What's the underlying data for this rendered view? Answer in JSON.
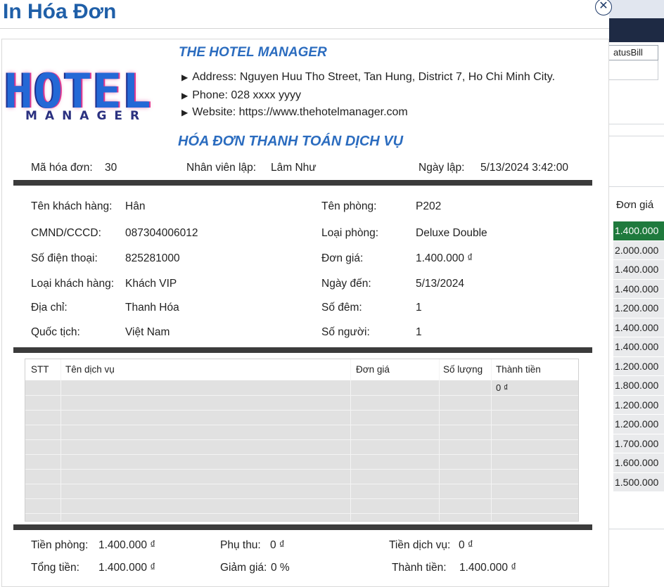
{
  "dialog": {
    "title": "In Hóa Đơn",
    "close_glyph": "✕"
  },
  "logo": {
    "main": "HOTEL",
    "sub": "MANAGER"
  },
  "company": {
    "name": "THE HOTEL MANAGER",
    "arrow": "▶",
    "address": "Address: Nguyen Huu Tho Street, Tan Hung, District 7, Ho Chi Minh City.",
    "phone": "Phone: 028 xxxx yyyy",
    "website": "Website: https://www.thehotelmanager.com"
  },
  "invoice": {
    "heading": "HÓA ĐƠN THANH TOÁN DỊCH VỤ",
    "id_label": "Mã hóa đơn:",
    "id_value": "30",
    "staff_label": "Nhân viên lập:",
    "staff_value": "Lâm Như",
    "date_label": "Ngày lập:",
    "date_value": "5/13/2024 3:42:00"
  },
  "customer": {
    "name_label": "Tên khách hàng:",
    "name_value": "Hân",
    "id_label": "CMND/CCCD:",
    "id_value": "087304006012",
    "phone_label": "Số điện thoại:",
    "phone_value": "825281000",
    "type_label": "Loại khách hàng:",
    "type_value": "Khách VIP",
    "address_label": "Địa chỉ:",
    "address_value": "Thanh Hóa",
    "nationality_label": "Quốc tịch:",
    "nationality_value": "Việt Nam"
  },
  "room": {
    "name_label": "Tên phòng:",
    "name_value": "P202",
    "type_label": "Loại phòng:",
    "type_value": "Deluxe Double",
    "price_label": "Đơn giá:",
    "price_value": "1.400.000 ₫",
    "arrival_label": "Ngày đến:",
    "arrival_value": "5/13/2024",
    "nights_label": "Số đêm:",
    "nights_value": "1",
    "people_label": "Số người:",
    "people_value": "1"
  },
  "services": {
    "columns": [
      "STT",
      "Tên dịch vụ",
      "Đơn giá",
      "Số lượng",
      "Thành tiền"
    ],
    "first_total": "0 ₫"
  },
  "summary": {
    "room_fee_label": "Tiền phòng:",
    "room_fee_value": "1.400.000 ₫",
    "surcharge_label": "Phụ thu:",
    "surcharge_value": "0 ₫",
    "service_fee_label": "Tiền dịch vụ:",
    "service_fee_value": "0 ₫",
    "total_label": "Tổng tiền:",
    "total_value": "1.400.000 ₫",
    "discount_label": "Giảm giá:",
    "discount_value": "0 %",
    "final_label": "Thành tiền:",
    "final_value": "1.400.000 ₫"
  },
  "background": {
    "status_text": "atusBill",
    "column_header": "Đơn giá",
    "prices": [
      "1.400.000",
      "2.000.000",
      "1.400.000",
      "1.400.000",
      "1.200.000",
      "1.400.000",
      "1.400.000",
      "1.200.000",
      "1.800.000",
      "1.200.000",
      "1.200.000",
      "1.700.000",
      "1.600.000",
      "1.500.000"
    ]
  },
  "colors": {
    "title": "#1f5fa8",
    "accent": "#2b6cbf",
    "bar": "#3b3b3b",
    "selected_row": "#1f7a3d"
  }
}
